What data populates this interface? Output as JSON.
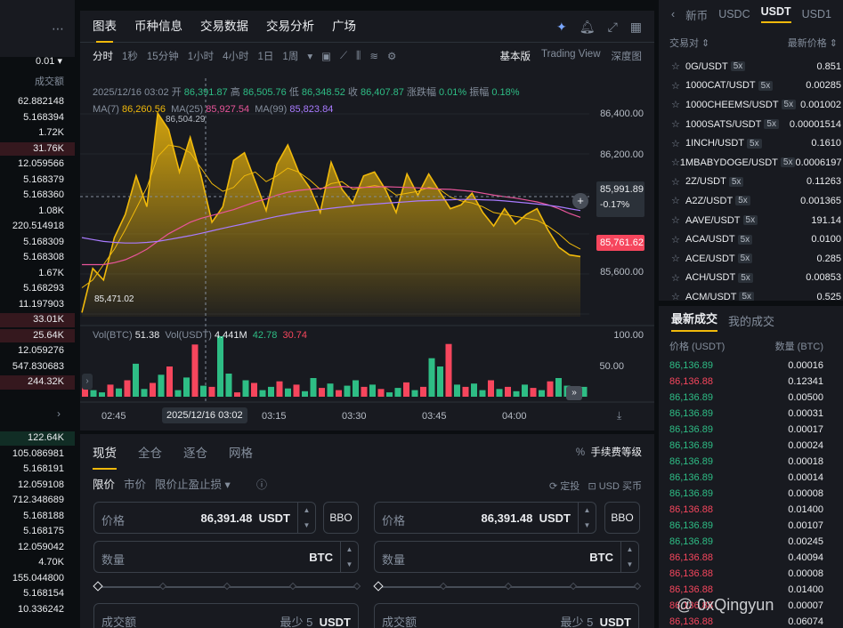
{
  "orderbook": {
    "precision": "0.01 ▾",
    "amount_header": "成交额",
    "asks": [
      {
        "v": "62.882148",
        "w": 0
      },
      {
        "v": "5.168394",
        "w": 0
      },
      {
        "v": "1.72K",
        "w": 0
      },
      {
        "v": "31.76K",
        "w": 1
      },
      {
        "v": "12.059566",
        "w": 0
      },
      {
        "v": "5.168379",
        "w": 0
      },
      {
        "v": "5.168360",
        "w": 0
      },
      {
        "v": "1.08K",
        "w": 0
      },
      {
        "v": "220.514918",
        "w": 0
      },
      {
        "v": "5.168309",
        "w": 0
      },
      {
        "v": "5.168308",
        "w": 0
      },
      {
        "v": "1.67K",
        "w": 0
      },
      {
        "v": "5.168293",
        "w": 0
      },
      {
        "v": "11.197903",
        "w": 0
      },
      {
        "v": "33.01K",
        "w": 1
      },
      {
        "v": "25.64K",
        "w": 1
      },
      {
        "v": "12.059276",
        "w": 0
      },
      {
        "v": "547.830683",
        "w": 0
      },
      {
        "v": "244.32K",
        "w": 1
      }
    ],
    "mid": "›",
    "bids": [
      {
        "v": "122.64K",
        "w": 1
      },
      {
        "v": "105.086981",
        "w": 0
      },
      {
        "v": "5.168191",
        "w": 0
      },
      {
        "v": "12.059108",
        "w": 0
      },
      {
        "v": "712.348689",
        "w": 0
      },
      {
        "v": "5.168188",
        "w": 0
      },
      {
        "v": "5.168175",
        "w": 0
      },
      {
        "v": "12.059042",
        "w": 0
      },
      {
        "v": "4.70K",
        "w": 0
      },
      {
        "v": "155.044800",
        "w": 0
      },
      {
        "v": "5.168154",
        "w": 0
      },
      {
        "v": "10.336242",
        "w": 0
      }
    ]
  },
  "chart": {
    "tabs": [
      "图表",
      "币种信息",
      "交易数据",
      "交易分析",
      "广场"
    ],
    "intervals": [
      "分时",
      "1秒",
      "15分钟",
      "1小时",
      "4小时",
      "1日",
      "1周"
    ],
    "views": [
      "基本版",
      "Trading View",
      "深度图"
    ],
    "ohlc": {
      "date": "2025/12/16 03:02",
      "open_label": "开",
      "open": "86,391.87",
      "high_label": "高",
      "high": "86,505.76",
      "low_label": "低",
      "low": "86,348.52",
      "close_label": "收",
      "close": "86,407.87",
      "chg_label": "涨跌幅",
      "chg": "0.01%",
      "amp_label": "振幅",
      "amp": "0.18%"
    },
    "ma": {
      "ma7_label": "MA(7)",
      "ma7": "86,260.56",
      "ma25_label": "MA(25)",
      "ma25": "85,927.54",
      "ma99_label": "MA(99)",
      "ma99": "85,823.84"
    },
    "vol": {
      "label": "Vol(BTC)",
      "btc": "51.38",
      "usdt_label": "Vol(USDT)",
      "usdt": "4.441M",
      "a": "42.78",
      "b": "30.74"
    },
    "high_mark": "86,504.29",
    "low_mark": "85,471.02",
    "price_tag": "85,991.89",
    "price_pct": "-0.17%",
    "last_tag": "85,761.62",
    "y_ticks": [
      "86,400.00",
      "86,200.00",
      "86,000.00",
      "85,800.00",
      "85,600.00"
    ],
    "vol_ticks": [
      "100.00",
      "50.00"
    ],
    "x_ticks": [
      "02:45",
      "2025/12/16 03:02",
      "03:15",
      "03:30",
      "03:45",
      "04:00"
    ]
  },
  "chart_data": {
    "type": "area",
    "title": "",
    "xlabel": "",
    "ylabel": "",
    "ylim": [
      85450,
      86520
    ],
    "x": [
      "02:45",
      "03:02",
      "03:15",
      "03:30",
      "03:45",
      "04:00"
    ],
    "series": [
      {
        "name": "Price",
        "values": [
          85471,
          85700,
          85640,
          85860,
          85980,
          86180,
          86020,
          86505,
          86420,
          86200,
          86380,
          86180,
          85940,
          86020,
          86260,
          86300,
          86150,
          86000,
          86240,
          86340,
          86200,
          86120,
          85990,
          86250,
          86110,
          86040,
          86180,
          86200,
          86110,
          85990,
          86190,
          86080,
          86190,
          86100,
          86010,
          86030,
          86090,
          85990,
          85920,
          86010,
          85930,
          85980,
          86010,
          85900,
          85810,
          85770,
          85762
        ]
      },
      {
        "name": "MA(7)",
        "values": [
          85600,
          85640,
          85720,
          85800,
          85900,
          86010,
          86120,
          86280,
          86340,
          86330,
          86300,
          86220,
          86140,
          86100,
          86120,
          86180,
          86200,
          86150,
          86180,
          86220,
          86200,
          86160,
          86110,
          86140,
          86150,
          86110,
          86120,
          86130,
          86120,
          86080,
          86090,
          86100,
          86120,
          86110,
          86070,
          86050,
          86040,
          86020,
          85990,
          85980,
          85970,
          85960,
          85950,
          85920,
          85880,
          85830,
          85800
        ]
      },
      {
        "name": "MA(25)",
        "values": [
          85720,
          85720,
          85720,
          85730,
          85745,
          85770,
          85800,
          85840,
          85880,
          85910,
          85940,
          85960,
          85975,
          85990,
          86005,
          86025,
          86045,
          86060,
          86080,
          86095,
          86105,
          86110,
          86115,
          86120,
          86125,
          86120,
          86120,
          86122,
          86124,
          86122,
          86120,
          86118,
          86115,
          86112,
          86110,
          86105,
          86100,
          86090,
          86080,
          86072,
          86065,
          86055,
          86045,
          86030,
          86010,
          85985,
          85965
        ]
      },
      {
        "name": "MA(99)",
        "values": [
          85860,
          85850,
          85840,
          85835,
          85832,
          85832,
          85835,
          85840,
          85850,
          85860,
          85870,
          85882,
          85895,
          85908,
          85920,
          85932,
          85945,
          85958,
          85970,
          85980,
          85990,
          85998,
          86005,
          86012,
          86018,
          86024,
          86030,
          86034,
          86038,
          86042,
          86046,
          86050,
          86052,
          86054,
          86056,
          86058,
          86058,
          86056,
          86054,
          86050,
          86045,
          86040,
          86034,
          86028,
          86020,
          86010,
          86000
        ]
      }
    ],
    "volume": [
      18,
      12,
      8,
      22,
      15,
      30,
      60,
      14,
      25,
      40,
      55,
      12,
      35,
      95,
      20,
      18,
      110,
      42,
      8,
      30,
      25,
      12,
      18,
      28,
      15,
      22,
      10,
      34,
      16,
      24,
      12,
      20,
      30,
      18,
      22,
      14,
      8,
      16,
      26,
      12,
      18,
      70,
      55,
      96,
      22,
      18,
      24,
      12,
      30,
      14,
      18,
      10,
      22,
      16,
      12,
      28,
      34,
      20,
      14,
      18
    ],
    "volume_ylim": [
      0,
      110
    ]
  },
  "form": {
    "tabs": [
      "现货",
      "全仓",
      "逐仓",
      "网格"
    ],
    "fee_label": "手续费等级",
    "types": [
      "限价",
      "市价",
      "限价止盈止损 ▾"
    ],
    "opts": [
      "定投",
      "USD 买币"
    ],
    "price_label": "价格",
    "price_val": "86,391.48",
    "unit_usdt": "USDT",
    "bbo": "BBO",
    "qty_label": "数量",
    "unit_btc": "BTC",
    "total_label": "成交额",
    "min_label": "最少 5"
  },
  "market": {
    "tabs": [
      "新币",
      "USDC",
      "USDT",
      "USD1"
    ],
    "col_pair": "交易对 ⇕",
    "col_price": "最新价格 ⇕",
    "rows": [
      {
        "pair": "0G/USDT",
        "lev": "5x",
        "px": "0.851"
      },
      {
        "pair": "1000CAT/USDT",
        "lev": "5x",
        "px": "0.00285"
      },
      {
        "pair": "1000CHEEMS/USDT",
        "lev": "5x",
        "px": "0.001002"
      },
      {
        "pair": "1000SATS/USDT",
        "lev": "5x",
        "px": "0.00001514"
      },
      {
        "pair": "1INCH/USDT",
        "lev": "5x",
        "px": "0.1610"
      },
      {
        "pair": "1MBABYDOGE/USDT",
        "lev": "5x",
        "px": "0.0006197"
      },
      {
        "pair": "2Z/USDT",
        "lev": "5x",
        "px": "0.11263"
      },
      {
        "pair": "A2Z/USDT",
        "lev": "5x",
        "px": "0.001365"
      },
      {
        "pair": "AAVE/USDT",
        "lev": "5x",
        "px": "191.14"
      },
      {
        "pair": "ACA/USDT",
        "lev": "5x",
        "px": "0.0100"
      },
      {
        "pair": "ACE/USDT",
        "lev": "5x",
        "px": "0.285"
      },
      {
        "pair": "ACH/USDT",
        "lev": "5x",
        "px": "0.00853"
      },
      {
        "pair": "ACM/USDT",
        "lev": "5x",
        "px": "0.525"
      }
    ]
  },
  "trades": {
    "tabs": [
      "最新成交",
      "我的成交"
    ],
    "col_price": "价格 (USDT)",
    "col_amt": "数量 (BTC)",
    "rows": [
      {
        "p": "86,136.89",
        "a": "0.00016",
        "s": "up"
      },
      {
        "p": "86,136.88",
        "a": "0.12341",
        "s": "dn"
      },
      {
        "p": "86,136.89",
        "a": "0.00500",
        "s": "up"
      },
      {
        "p": "86,136.89",
        "a": "0.00031",
        "s": "up"
      },
      {
        "p": "86,136.89",
        "a": "0.00017",
        "s": "up"
      },
      {
        "p": "86,136.89",
        "a": "0.00024",
        "s": "up"
      },
      {
        "p": "86,136.89",
        "a": "0.00018",
        "s": "up"
      },
      {
        "p": "86,136.89",
        "a": "0.00014",
        "s": "up"
      },
      {
        "p": "86,136.89",
        "a": "0.00008",
        "s": "up"
      },
      {
        "p": "86,136.88",
        "a": "0.01400",
        "s": "dn"
      },
      {
        "p": "86,136.89",
        "a": "0.00107",
        "s": "up"
      },
      {
        "p": "86,136.89",
        "a": "0.00245",
        "s": "up"
      },
      {
        "p": "86,136.88",
        "a": "0.40094",
        "s": "dn"
      },
      {
        "p": "86,136.88",
        "a": "0.00008",
        "s": "dn"
      },
      {
        "p": "86,136.88",
        "a": "0.01400",
        "s": "dn"
      },
      {
        "p": "86,136.88",
        "a": "0.00007",
        "s": "dn"
      },
      {
        "p": "86,136.88",
        "a": "0.06074",
        "s": "dn"
      }
    ]
  },
  "watermark": "@ 0xQingyun",
  "colors": {
    "up": "#2ebd85",
    "down": "#f6465d",
    "accent": "#f0b90b",
    "ma7": "#f0b90b",
    "ma25": "#e8559a",
    "ma99": "#a97bff"
  }
}
